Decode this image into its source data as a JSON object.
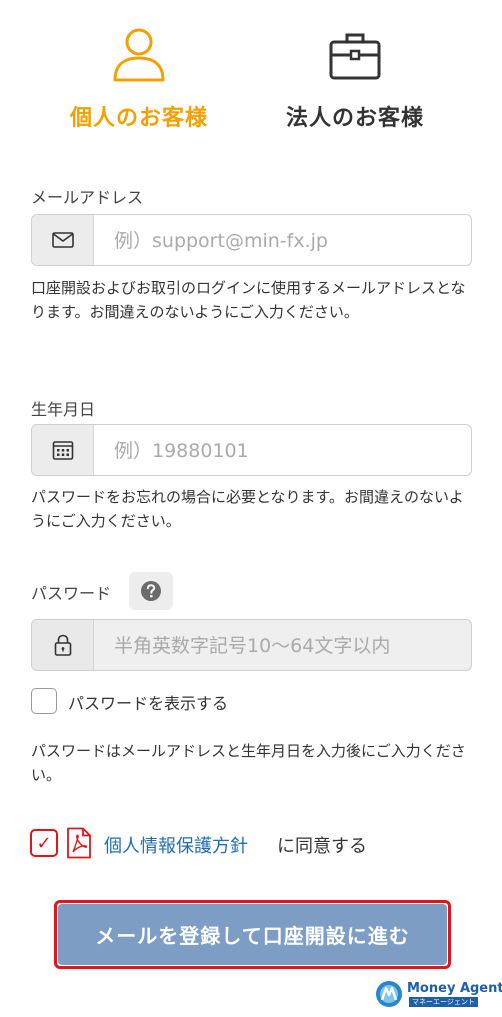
{
  "tabs": {
    "personal": {
      "label": "個人のお客様",
      "active": true,
      "color": "#f5a000"
    },
    "corporate": {
      "label": "法人のお客様",
      "active": false
    }
  },
  "email": {
    "label": "メールアドレス",
    "placeholder": "例）support@min-fx.jp",
    "icon": "envelope-icon",
    "help": "口座開設およびお取引のログインに使用するメールアドレスとなります。お間違えのないようにご入力ください。"
  },
  "birthdate": {
    "label": "生年月日",
    "placeholder": "例）19880101",
    "icon": "calendar-icon",
    "help": "パスワードをお忘れの場合に必要となります。お間違えのないようにご入力ください。"
  },
  "password": {
    "label": "パスワード",
    "placeholder": "半角英数字記号10〜64文字以内",
    "icon": "lock-icon",
    "help_icon": "question-icon",
    "show_label": "パスワードを表示する",
    "show_checked": false,
    "help": "パスワードはメールアドレスと生年月日を入力後にご入力ください。"
  },
  "agreement": {
    "checked": true,
    "check_mark": "✓",
    "link_text": "個人情報保護方針",
    "suffix": "に同意する",
    "icon": "pdf-icon"
  },
  "submit": {
    "label": "メールを登録して口座開設に進む",
    "color": "#7d9dc4",
    "highlight_color": "#e0161d"
  },
  "brand": {
    "name": "Money Agent",
    "sub": "マネーエージェント"
  }
}
